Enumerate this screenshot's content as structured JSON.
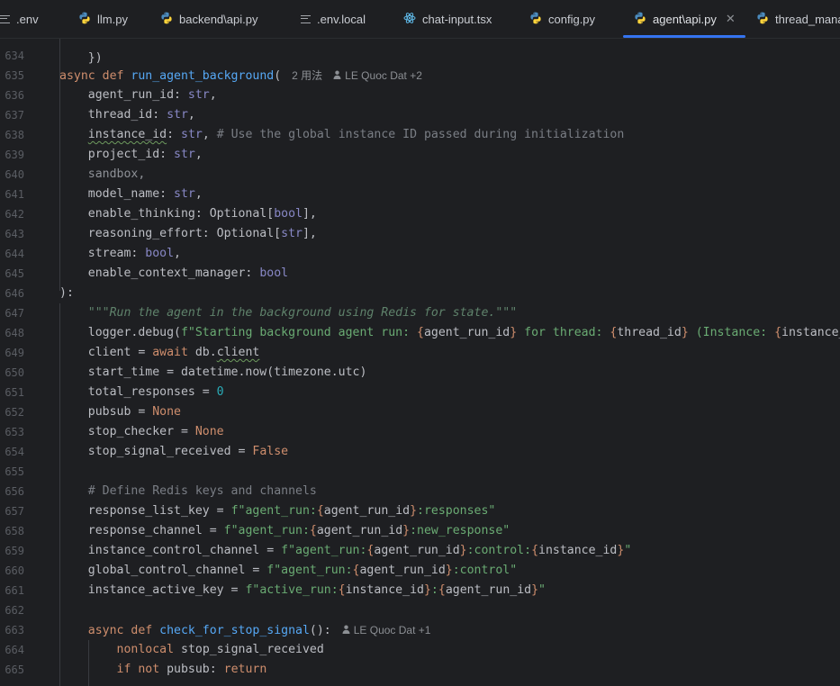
{
  "tabs": [
    {
      "label": ".env",
      "icon": "text-file-icon",
      "active": false
    },
    {
      "label": "llm.py",
      "icon": "python-icon",
      "active": false
    },
    {
      "label": "backend\\api.py",
      "icon": "python-icon",
      "active": false
    },
    {
      "label": ".env.local",
      "icon": "text-file-icon",
      "active": false
    },
    {
      "label": "chat-input.tsx",
      "icon": "react-icon",
      "active": false
    },
    {
      "label": "config.py",
      "icon": "python-icon",
      "active": false
    },
    {
      "label": "agent\\api.py",
      "icon": "python-icon",
      "active": true
    },
    {
      "label": "thread_mana",
      "icon": "python-icon",
      "active": false
    }
  ],
  "colors": {
    "background": "#1e1f22",
    "keyword": "#cf8e6d",
    "function": "#56a8f5",
    "builtin_type": "#8888c6",
    "string": "#6aab73",
    "number": "#2aacb8",
    "comment": "#7a7e85",
    "docstring": "#5f826b",
    "active_tab_underline": "#3574f0"
  },
  "inlay_hints": {
    "fn_usages": "2 用法",
    "fn_author": "LE Quoc Dat +2",
    "inner_author": "LE Quoc Dat +1"
  },
  "lines": [
    {
      "n": "634",
      "tokens": []
    },
    {
      "n": "635",
      "tokens": [
        {
          "t": "async def ",
          "c": "kw"
        },
        {
          "t": "run_agent_background",
          "c": "fn"
        },
        {
          "t": "(",
          "c": ""
        }
      ],
      "hint": "fn"
    },
    {
      "n": "636",
      "tokens": [
        {
          "t": "    agent_run_id: ",
          "c": ""
        },
        {
          "t": "str",
          "c": "tp"
        },
        {
          "t": ",",
          "c": ""
        }
      ]
    },
    {
      "n": "637",
      "tokens": [
        {
          "t": "    thread_id: ",
          "c": ""
        },
        {
          "t": "str",
          "c": "tp"
        },
        {
          "t": ",",
          "c": ""
        }
      ]
    },
    {
      "n": "638",
      "tokens": [
        {
          "t": "    ",
          "c": ""
        },
        {
          "t": "instance_id",
          "c": "typo"
        },
        {
          "t": ": ",
          "c": ""
        },
        {
          "t": "str",
          "c": "tp"
        },
        {
          "t": ", ",
          "c": ""
        },
        {
          "t": "# Use the global instance ID passed during initialization",
          "c": "cm"
        }
      ]
    },
    {
      "n": "639",
      "tokens": [
        {
          "t": "    project_id: ",
          "c": ""
        },
        {
          "t": "str",
          "c": "tp"
        },
        {
          "t": ",",
          "c": ""
        }
      ]
    },
    {
      "n": "640",
      "tokens": [
        {
          "t": "    sandbox,",
          "c": "dim"
        }
      ]
    },
    {
      "n": "641",
      "tokens": [
        {
          "t": "    model_name: ",
          "c": ""
        },
        {
          "t": "str",
          "c": "tp"
        },
        {
          "t": ",",
          "c": ""
        }
      ]
    },
    {
      "n": "642",
      "tokens": [
        {
          "t": "    enable_thinking: Optional[",
          "c": ""
        },
        {
          "t": "bool",
          "c": "tp"
        },
        {
          "t": "],",
          "c": ""
        }
      ]
    },
    {
      "n": "643",
      "tokens": [
        {
          "t": "    reasoning_effort: Optional[",
          "c": ""
        },
        {
          "t": "str",
          "c": "tp"
        },
        {
          "t": "],",
          "c": ""
        }
      ]
    },
    {
      "n": "644",
      "tokens": [
        {
          "t": "    stream: ",
          "c": ""
        },
        {
          "t": "bool",
          "c": "tp"
        },
        {
          "t": ",",
          "c": ""
        }
      ]
    },
    {
      "n": "645",
      "tokens": [
        {
          "t": "    enable_context_manager: ",
          "c": ""
        },
        {
          "t": "bool",
          "c": "tp"
        }
      ]
    },
    {
      "n": "646",
      "tokens": [
        {
          "t": "):",
          "c": ""
        }
      ]
    },
    {
      "n": "647",
      "tokens": [
        {
          "t": "    ",
          "c": ""
        },
        {
          "t": "\"\"\"Run the agent in the background using Redis for state.\"\"\"",
          "c": "doc"
        }
      ]
    },
    {
      "n": "648",
      "tokens": [
        {
          "t": "    logger.debug(",
          "c": ""
        },
        {
          "t": "f\"Starting background agent run: ",
          "c": "st"
        },
        {
          "t": "{",
          "c": "kw"
        },
        {
          "t": "agent_run_id",
          "c": ""
        },
        {
          "t": "}",
          "c": "kw"
        },
        {
          "t": " for thread: ",
          "c": "st"
        },
        {
          "t": "{",
          "c": "kw"
        },
        {
          "t": "thread_id",
          "c": ""
        },
        {
          "t": "}",
          "c": "kw"
        },
        {
          "t": " (Instance: ",
          "c": "st"
        },
        {
          "t": "{",
          "c": "kw"
        },
        {
          "t": "instance_id",
          "c": ""
        },
        {
          "t": "})\")",
          "c": "st"
        }
      ]
    },
    {
      "n": "649",
      "tokens": [
        {
          "t": "    client = ",
          "c": ""
        },
        {
          "t": "await ",
          "c": "kw"
        },
        {
          "t": "db.",
          "c": ""
        },
        {
          "t": "client",
          "c": "typo"
        }
      ]
    },
    {
      "n": "650",
      "tokens": [
        {
          "t": "    start_time = datetime.now(timezone.utc)",
          "c": ""
        }
      ]
    },
    {
      "n": "651",
      "tokens": [
        {
          "t": "    total_responses = ",
          "c": ""
        },
        {
          "t": "0",
          "c": "num"
        }
      ]
    },
    {
      "n": "652",
      "tokens": [
        {
          "t": "    pubsub = ",
          "c": ""
        },
        {
          "t": "None",
          "c": "kw"
        }
      ]
    },
    {
      "n": "653",
      "tokens": [
        {
          "t": "    stop_checker = ",
          "c": ""
        },
        {
          "t": "None",
          "c": "kw"
        }
      ]
    },
    {
      "n": "654",
      "tokens": [
        {
          "t": "    stop_signal_received = ",
          "c": ""
        },
        {
          "t": "False",
          "c": "kw"
        }
      ]
    },
    {
      "n": "655",
      "tokens": []
    },
    {
      "n": "656",
      "tokens": [
        {
          "t": "    ",
          "c": ""
        },
        {
          "t": "# Define Redis keys and channels",
          "c": "cm"
        }
      ]
    },
    {
      "n": "657",
      "tokens": [
        {
          "t": "    response_list_key = ",
          "c": ""
        },
        {
          "t": "f\"agent_run:",
          "c": "st"
        },
        {
          "t": "{",
          "c": "kw"
        },
        {
          "t": "agent_run_id",
          "c": ""
        },
        {
          "t": "}",
          "c": "kw"
        },
        {
          "t": ":responses\"",
          "c": "st"
        }
      ]
    },
    {
      "n": "658",
      "tokens": [
        {
          "t": "    response_channel = ",
          "c": ""
        },
        {
          "t": "f\"agent_run:",
          "c": "st"
        },
        {
          "t": "{",
          "c": "kw"
        },
        {
          "t": "agent_run_id",
          "c": ""
        },
        {
          "t": "}",
          "c": "kw"
        },
        {
          "t": ":new_response\"",
          "c": "st"
        }
      ]
    },
    {
      "n": "659",
      "tokens": [
        {
          "t": "    instance_control_channel = ",
          "c": ""
        },
        {
          "t": "f\"agent_run:",
          "c": "st"
        },
        {
          "t": "{",
          "c": "kw"
        },
        {
          "t": "agent_run_id",
          "c": ""
        },
        {
          "t": "}",
          "c": "kw"
        },
        {
          "t": ":control:",
          "c": "st"
        },
        {
          "t": "{",
          "c": "kw"
        },
        {
          "t": "instance_id",
          "c": ""
        },
        {
          "t": "}",
          "c": "kw"
        },
        {
          "t": "\"",
          "c": "st"
        }
      ]
    },
    {
      "n": "660",
      "tokens": [
        {
          "t": "    global_control_channel = ",
          "c": ""
        },
        {
          "t": "f\"agent_run:",
          "c": "st"
        },
        {
          "t": "{",
          "c": "kw"
        },
        {
          "t": "agent_run_id",
          "c": ""
        },
        {
          "t": "}",
          "c": "kw"
        },
        {
          "t": ":control\"",
          "c": "st"
        }
      ]
    },
    {
      "n": "661",
      "tokens": [
        {
          "t": "    instance_active_key = ",
          "c": ""
        },
        {
          "t": "f\"active_run:",
          "c": "st"
        },
        {
          "t": "{",
          "c": "kw"
        },
        {
          "t": "instance_id",
          "c": ""
        },
        {
          "t": "}",
          "c": "kw"
        },
        {
          "t": ":",
          "c": "st"
        },
        {
          "t": "{",
          "c": "kw"
        },
        {
          "t": "agent_run_id",
          "c": ""
        },
        {
          "t": "}",
          "c": "kw"
        },
        {
          "t": "\"",
          "c": "st"
        }
      ]
    },
    {
      "n": "662",
      "tokens": []
    },
    {
      "n": "663",
      "tokens": [
        {
          "t": "    ",
          "c": ""
        },
        {
          "t": "async def ",
          "c": "kw"
        },
        {
          "t": "check_for_stop_signal",
          "c": "fn"
        },
        {
          "t": "():",
          "c": ""
        }
      ],
      "hint": "inner"
    },
    {
      "n": "664",
      "tokens": [
        {
          "t": "        ",
          "c": ""
        },
        {
          "t": "nonlocal ",
          "c": "kw"
        },
        {
          "t": "stop_signal_received",
          "c": ""
        }
      ]
    },
    {
      "n": "665",
      "tokens": [
        {
          "t": "        ",
          "c": ""
        },
        {
          "t": "if not ",
          "c": "kw"
        },
        {
          "t": "pubsub: ",
          "c": ""
        },
        {
          "t": "return",
          "c": "kw"
        }
      ]
    }
  ]
}
